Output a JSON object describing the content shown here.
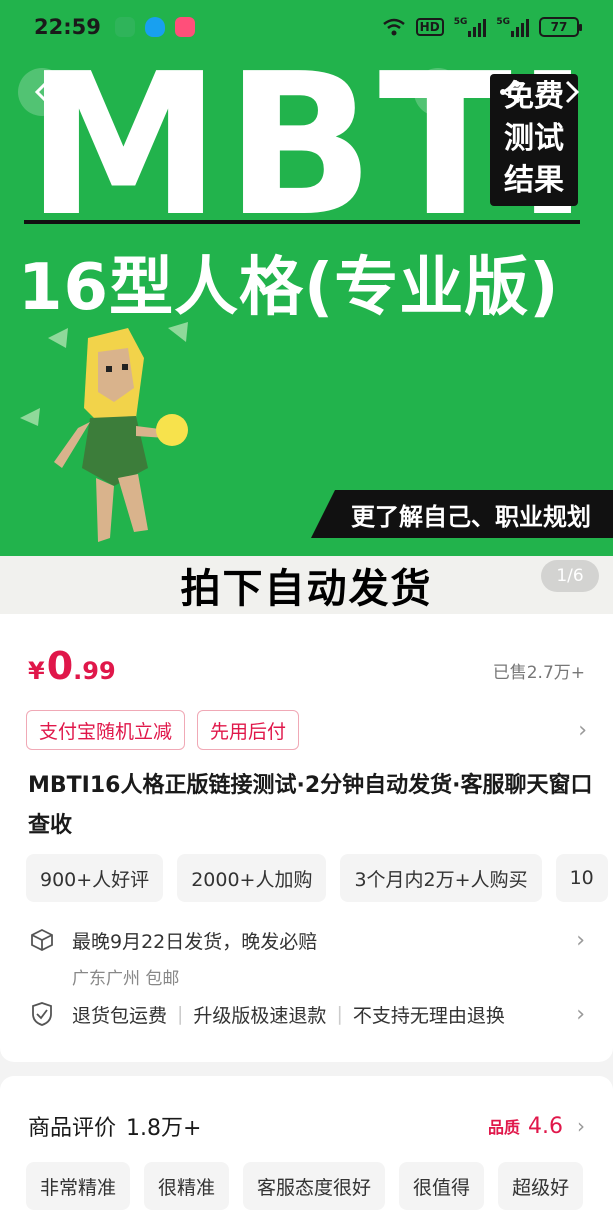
{
  "status_bar": {
    "time": "22:59",
    "hd": "HD",
    "net1": "5G",
    "net2": "5G",
    "battery": "77"
  },
  "hero": {
    "brand": "MBTI",
    "badge": [
      "免费",
      "测试",
      "结果"
    ],
    "subtitle": "16型人格(专业版)",
    "tagline": "更了解自己、职业规划",
    "cta": "拍下自动发货",
    "page_indicator": "1/6",
    "colors": {
      "background": "#22b34c",
      "text": "#ffffff",
      "badge": "#111111"
    }
  },
  "product": {
    "price_symbol": "¥",
    "price_int": "0",
    "price_dec": ".99",
    "sold": "已售2.7万+",
    "promo_tags": [
      "支付宝随机立减",
      "先用后付"
    ],
    "title": "MBTI16人格正版链接测试·2分钟自动发货·客服聊天窗口查收",
    "chips": [
      "900+人好评",
      "2000+人加购",
      "3个月内2万+人购买",
      "10"
    ],
    "shipping": {
      "main": "最晚9月22日发货，晚发必赔",
      "sub": "广东广州 包邮"
    },
    "guarantees": [
      "退货包运费",
      "升级版极速退款",
      "不支持无理由退换"
    ],
    "accent_color": "#e0174a"
  },
  "reviews": {
    "title": "商品评价",
    "count": "1.8万+",
    "quality_label": "品质",
    "quality_score": "4.6",
    "chips": [
      "非常精准",
      "很精准",
      "客服态度很好",
      "很值得",
      "超级好"
    ]
  }
}
